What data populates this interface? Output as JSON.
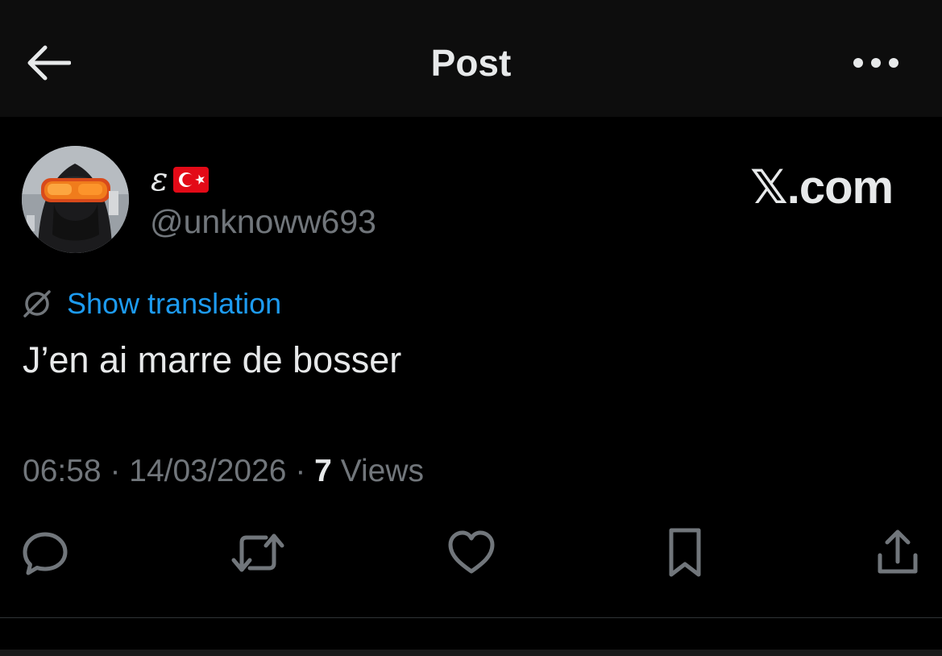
{
  "header": {
    "title": "Post",
    "back_icon": "arrow-left-icon",
    "more_icon": "ellipsis-icon"
  },
  "author": {
    "display_name": "ε",
    "flag": "turkey-flag",
    "handle": "@unknoww693"
  },
  "watermark": {
    "x": "𝕏",
    "domain": ".com"
  },
  "post": {
    "translate_label": "Show translation",
    "text": "J’en ai marre de bosser",
    "time": "06:58",
    "sep1": " · ",
    "date": "14/03/2026",
    "sep2": " · ",
    "views_count": "7",
    "views_label": " Views"
  },
  "actions": [
    "reply-icon",
    "retweet-icon",
    "like-icon",
    "bookmark-icon",
    "share-icon"
  ],
  "colors": {
    "background": "#000000",
    "header_bg": "#0d0d0d",
    "text": "#e7e9ea",
    "muted": "#71767b",
    "link": "#1d9bf0",
    "flag_red": "#e30a17"
  }
}
